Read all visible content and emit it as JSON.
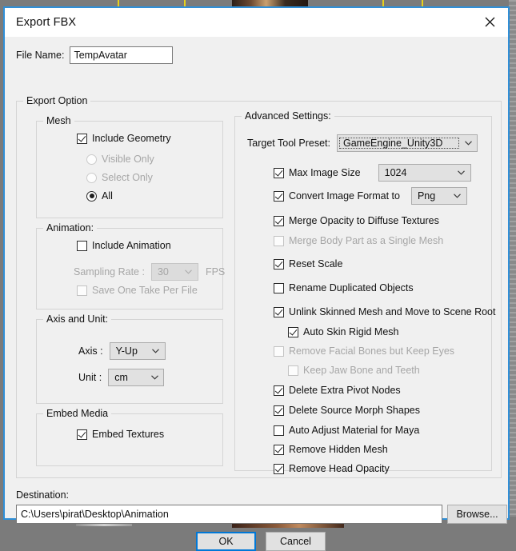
{
  "window": {
    "title": "Export FBX",
    "close_icon": "close-icon"
  },
  "file_name": {
    "label": "File Name:",
    "value": "TempAvatar",
    "placeholder": ""
  },
  "export_option": {
    "legend": "Export Option",
    "mesh": {
      "legend": "Mesh",
      "include_geometry": {
        "label": "Include Geometry",
        "checked": true,
        "enabled": true
      },
      "radios": [
        {
          "label": "Visible Only",
          "selected": false,
          "enabled": false
        },
        {
          "label": "Select Only",
          "selected": false,
          "enabled": false
        },
        {
          "label": "All",
          "selected": true,
          "enabled": true
        }
      ]
    },
    "animation": {
      "legend": "Animation:",
      "include_animation": {
        "label": "Include Animation",
        "checked": false,
        "enabled": true
      },
      "sampling_rate_label": "Sampling Rate :",
      "sampling_rate_value": "30",
      "fps_label": "FPS",
      "save_one_take": {
        "label": "Save One Take Per File",
        "checked": false,
        "enabled": false
      }
    },
    "axis_unit": {
      "legend": "Axis and Unit:",
      "axis_label": "Axis :",
      "axis_value": "Y-Up",
      "unit_label": "Unit :",
      "unit_value": "cm"
    },
    "embed_media": {
      "legend": "Embed Media",
      "embed_textures": {
        "label": "Embed Textures",
        "checked": true,
        "enabled": true
      }
    },
    "advanced": {
      "legend": "Advanced Settings:",
      "target_tool_preset_label": "Target Tool Preset:",
      "target_tool_preset_value": "GameEngine_Unity3D",
      "max_image_size": {
        "label": "Max Image Size",
        "checked": true,
        "enabled": true,
        "value": "1024"
      },
      "convert_image_format": {
        "label": "Convert Image Format to",
        "checked": true,
        "enabled": true,
        "value": "Png"
      },
      "options": [
        {
          "label": "Merge Opacity to Diffuse Textures",
          "checked": true,
          "enabled": true,
          "indent": 0
        },
        {
          "label": "Merge Body Part as a Single Mesh",
          "checked": false,
          "enabled": false,
          "indent": 0
        },
        {
          "label": "Reset Scale",
          "checked": true,
          "enabled": true,
          "indent": 0
        },
        {
          "label": "Rename Duplicated Objects",
          "checked": false,
          "enabled": true,
          "indent": 0
        },
        {
          "label": "Unlink Skinned Mesh and Move to Scene Root",
          "checked": true,
          "enabled": true,
          "indent": 0
        },
        {
          "label": "Auto Skin Rigid Mesh",
          "checked": true,
          "enabled": true,
          "indent": 1
        },
        {
          "label": "Remove Facial Bones but Keep Eyes",
          "checked": false,
          "enabled": false,
          "indent": 0
        },
        {
          "label": "Keep Jaw Bone and Teeth",
          "checked": false,
          "enabled": false,
          "indent": 1
        },
        {
          "label": "Delete Extra Pivot Nodes",
          "checked": true,
          "enabled": true,
          "indent": 0
        },
        {
          "label": "Delete Source Morph Shapes",
          "checked": true,
          "enabled": true,
          "indent": 0
        },
        {
          "label": "Auto Adjust Material for Maya",
          "checked": false,
          "enabled": true,
          "indent": 0
        },
        {
          "label": "Remove Hidden Mesh",
          "checked": true,
          "enabled": true,
          "indent": 0
        },
        {
          "label": "Remove Head Opacity",
          "checked": true,
          "enabled": true,
          "indent": 0
        }
      ]
    }
  },
  "destination": {
    "label": "Destination:",
    "value": "C:\\Users\\pirat\\Desktop\\Animation",
    "browse_label": "Browse..."
  },
  "buttons": {
    "ok": "OK",
    "cancel": "Cancel"
  },
  "colors": {
    "window_border": "#2f8fd8",
    "focus_blue": "#0078d7",
    "dialog_bg": "#f0f0f0",
    "desktop_bg": "#7b7b7b",
    "timeline_tick": "#e8d21a"
  }
}
